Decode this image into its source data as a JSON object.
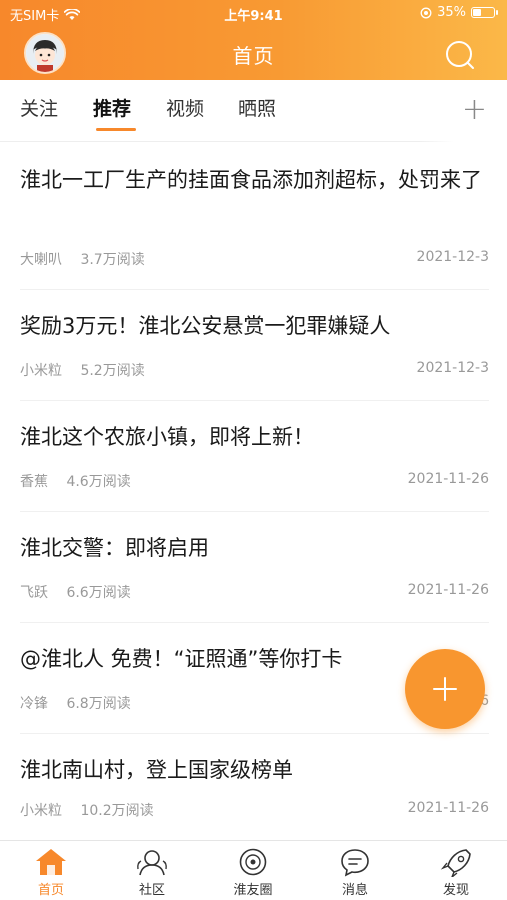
{
  "status_bar": {
    "carrier": "无SIM卡",
    "time": "上午9:41",
    "battery": "35%"
  },
  "header": {
    "title": "首页"
  },
  "tabs": [
    {
      "label": "关注",
      "active": false
    },
    {
      "label": "推荐",
      "active": true
    },
    {
      "label": "视频",
      "active": false
    },
    {
      "label": "晒照",
      "active": false
    }
  ],
  "feed": [
    {
      "title": "淮北一工厂生产的挂面食品添加剂超标，处罚来了",
      "source": "大喇叭",
      "reads": "3.7万阅读",
      "date": "2021-12-3"
    },
    {
      "title": "奖励3万元！淮北公安悬赏一犯罪嫌疑人",
      "source": "小米粒",
      "reads": "5.2万阅读",
      "date": "2021-12-3"
    },
    {
      "title": "淮北这个农旅小镇，即将上新！",
      "source": "香蕉",
      "reads": "4.6万阅读",
      "date": "2021-11-26"
    },
    {
      "title": "淮北交警：即将启用",
      "source": "飞跃",
      "reads": "6.6万阅读",
      "date": "2021-11-26"
    },
    {
      "title": "@淮北人 免费！“证照通”等你打卡",
      "source": "冷锋",
      "reads": "6.8万阅读",
      "date": "2021-11-26"
    },
    {
      "title": "淮北南山村，登上国家级榜单",
      "source": "小米粒",
      "reads": "10.2万阅读",
      "date": "2021-11-26"
    }
  ],
  "tabbar": [
    {
      "label": "首页",
      "icon": "home-icon",
      "active": true
    },
    {
      "label": "社区",
      "icon": "community-icon",
      "active": false
    },
    {
      "label": "淮友圈",
      "icon": "friends-circle-icon",
      "active": false
    },
    {
      "label": "消息",
      "icon": "message-icon",
      "active": false
    },
    {
      "label": "发现",
      "icon": "discover-icon",
      "active": false
    }
  ],
  "colors": {
    "accent": "#f7882b",
    "accent_light": "#fbb848"
  }
}
